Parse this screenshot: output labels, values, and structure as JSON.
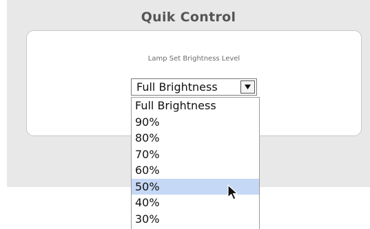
{
  "app": {
    "title": "Quik Control"
  },
  "panel": {
    "label": "Lamp Set Brightness Level"
  },
  "brightness_select": {
    "selected_value": "Full Brightness",
    "arrow_icon": "triangle-down-icon",
    "options": [
      "Full Brightness",
      "90%",
      "80%",
      "70%",
      "60%",
      "50%",
      "40%",
      "30%"
    ],
    "highlighted_option": "50%"
  },
  "colors": {
    "highlight": "#c5d8f5",
    "background_grey": "#e8e8e8"
  },
  "cursor": {
    "icon": "mouse-pointer-icon"
  }
}
